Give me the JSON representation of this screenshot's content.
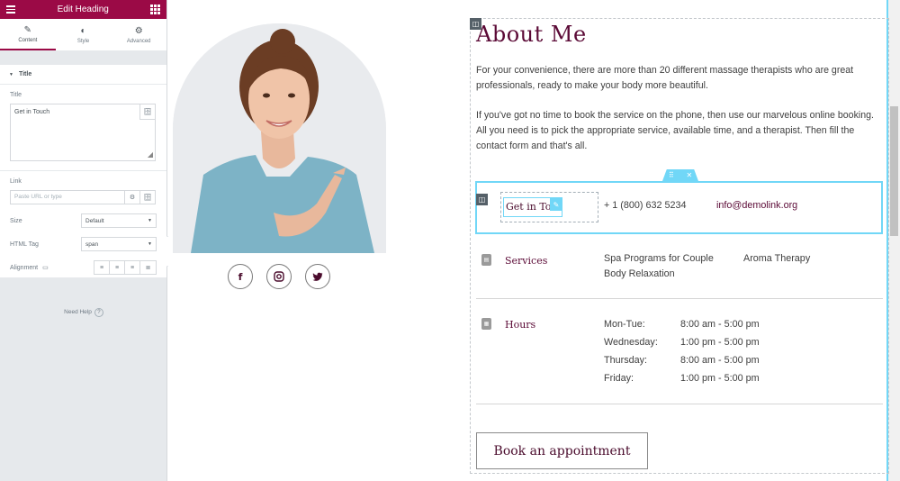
{
  "panel": {
    "title": "Edit Heading",
    "tabs": [
      {
        "label": "Content",
        "icon": "pencil-icon"
      },
      {
        "label": "Style",
        "icon": "half-circle-icon"
      },
      {
        "label": "Advanced",
        "icon": "gear-icon"
      }
    ],
    "section": "Title",
    "title_label": "Title",
    "title_value": "Get in Touch",
    "link_label": "Link",
    "link_placeholder": "Paste URL or type",
    "size_label": "Size",
    "size_value": "Default",
    "html_tag_label": "HTML Tag",
    "html_tag_value": "span",
    "alignment_label": "Alignment",
    "need_help": "Need Help"
  },
  "about": {
    "title": "About Me",
    "para1": "For your convenience, there are more than 20 different massage therapists who are great professionals, ready to make your body more beautiful.",
    "para2": "If you've got no time to book the service on the phone, then use our marvelous online booking. All you need is to pick the appropriate service, available time, and a therapist. Then fill the contact form and that's all."
  },
  "contact": {
    "heading": "Get in Touch",
    "phone": "+ 1 (800) 632 5234",
    "email": "info@demolink.org"
  },
  "services": {
    "title": "Services",
    "items": [
      "Spa Programs for Couple",
      "Aroma Therapy",
      "Body Relaxation"
    ]
  },
  "hours": {
    "title": "Hours",
    "rows": [
      {
        "day": "Mon-Tue:",
        "time": "8:00 am - 5:00 pm"
      },
      {
        "day": "Wednesday:",
        "time": "1:00 pm - 5:00 pm"
      },
      {
        "day": "Thursday:",
        "time": "8:00 am - 5:00 pm"
      },
      {
        "day": "Friday:",
        "time": "1:00 pm - 5:00 pm"
      }
    ]
  },
  "social": [
    "facebook-icon",
    "instagram-icon",
    "twitter-icon"
  ],
  "book_button": "Book an appointment",
  "colors": {
    "brand": "#9b0a46",
    "plum": "#5b0a36",
    "selection": "#71d7f7"
  }
}
